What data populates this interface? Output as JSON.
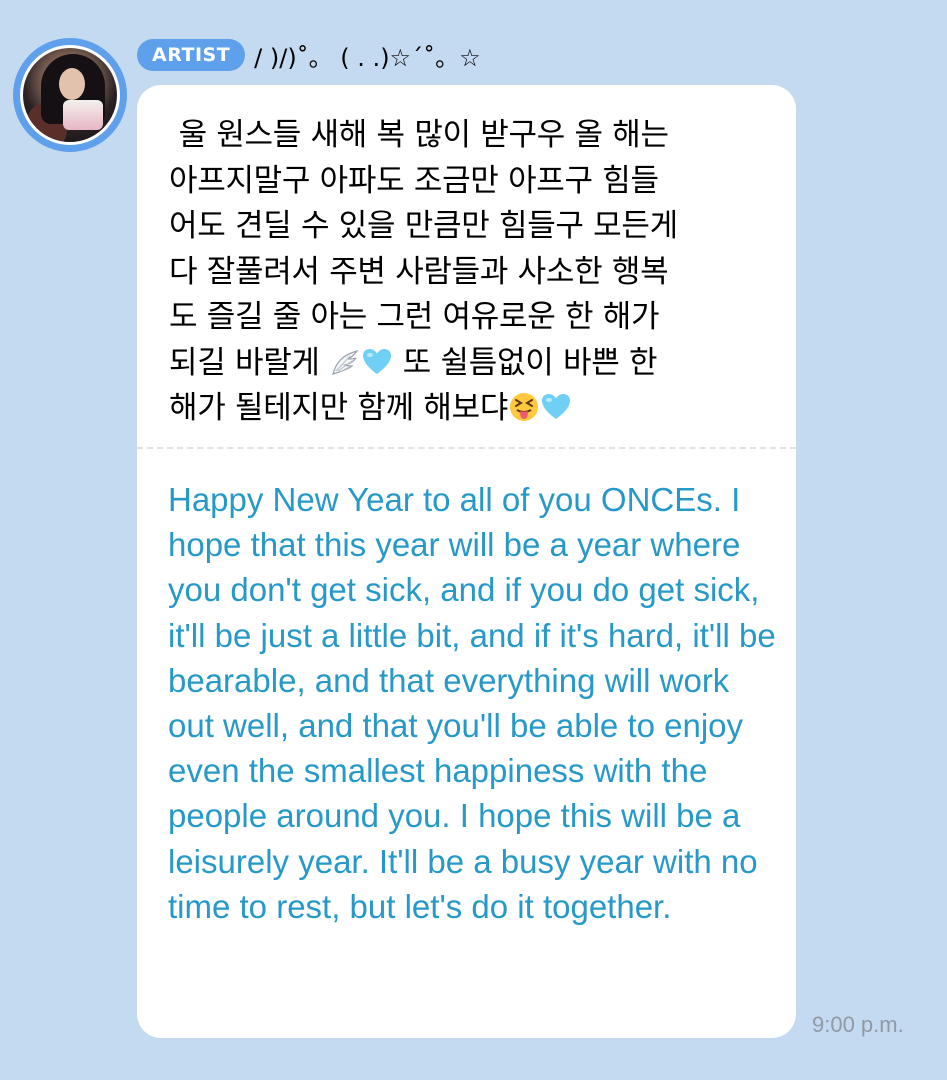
{
  "message": {
    "badge_label": "ARTIST",
    "sender_name": "/ )/)˚。 ( . .)☆´˚。☆",
    "korean_lines": [
      " 울 원스들 새해 복 많이 받구우 올 해는",
      "아프지말구 아파도 조금만 아프구 힘들",
      "어도 견딜 수 있을 만큼만 힘들구 모든게",
      "다 잘풀려서 주변 사람들과 사소한 행복",
      "도 즐길 줄 아는 그런 여유로운 한 해가",
      "되길 바랄게 ",
      " 또 쉴틈없이 바쁜 한",
      "해가 될테지만 함께 해보댜"
    ],
    "emojis": [
      "wing-emoji",
      "light-blue-heart-emoji",
      "squinting-tongue-emoji",
      "light-blue-heart-emoji"
    ],
    "english_translation": "Happy New Year to all of you ONCEs. I hope that this year will be a year where you don't get sick, and if you do get sick, it'll be just a little bit, and if it's hard, it'll be bearable, and that everything will work out well, and that you'll be able to enjoy even the smallest happiness with the people around you. I hope this will be a leisurely year. It'll be a busy year with no time to rest, but let's do it together.",
    "time": "9:00 p.m."
  },
  "colors": {
    "background": "#c4daf0",
    "accent": "#5fa0ec",
    "translation_text": "#2799c8",
    "time_text": "#8f9aa6"
  }
}
